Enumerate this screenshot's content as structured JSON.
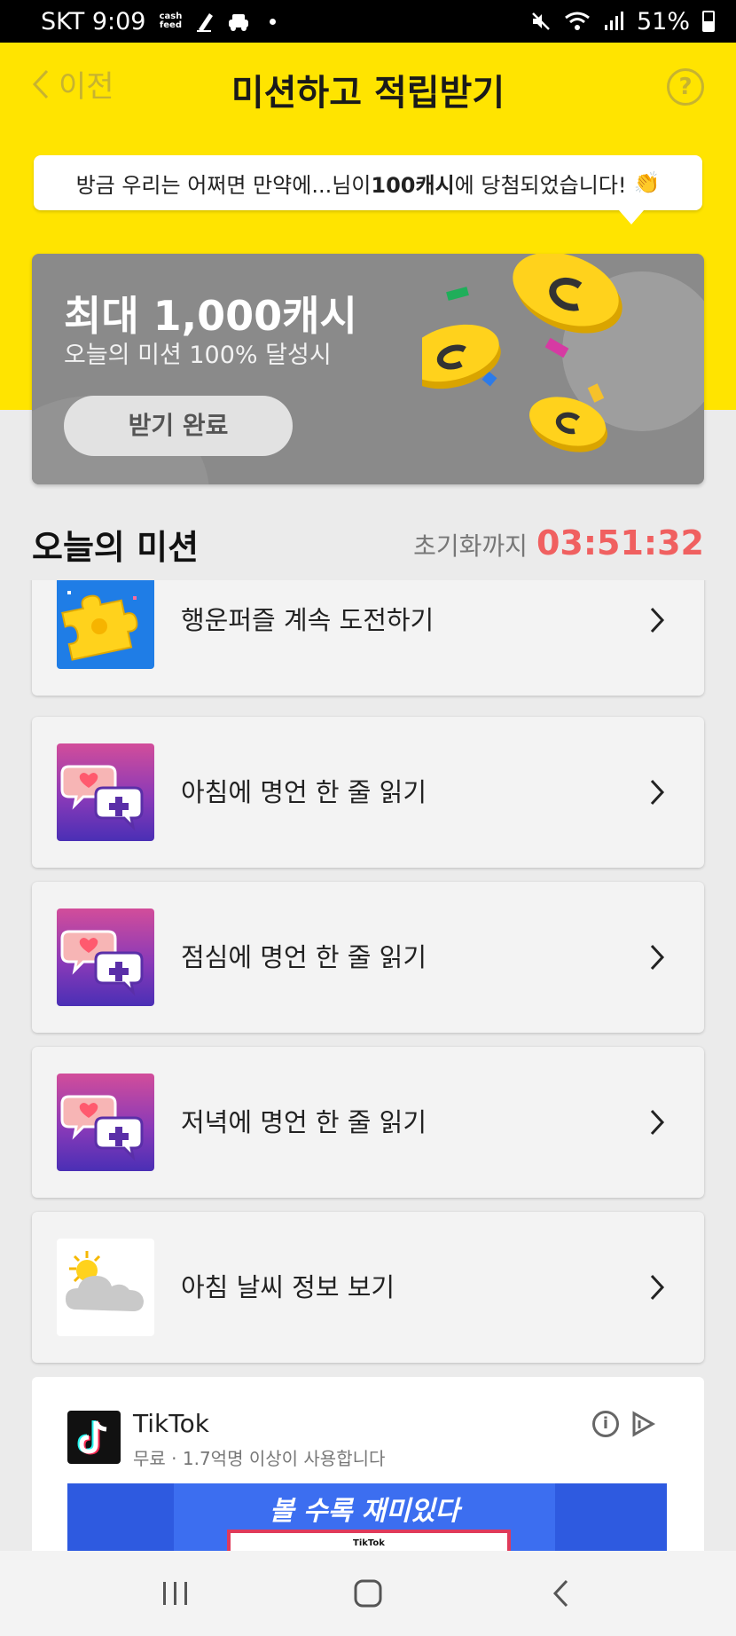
{
  "status_bar": {
    "carrier_time": "SKT 9:09",
    "app_badge": "cash feed",
    "battery": "51%"
  },
  "header": {
    "back_label": "이전",
    "title": "미션하고 적립받기",
    "help_label": "?"
  },
  "bubble": {
    "prefix": "방금 우리는 어쩌면 만약에...님이 ",
    "highlight": "100캐시",
    "suffix": "에 당첨되었습니다!",
    "emoji": "👏"
  },
  "promo": {
    "title": "최대 1,000캐시",
    "subtitle": "오늘의 미션 100% 달성시",
    "button_label": "받기 완료"
  },
  "section": {
    "title": "오늘의 미션",
    "reset_label": "초기화까지",
    "reset_time": "03:51:32"
  },
  "missions": [
    {
      "label": "행운퍼즐 계속 도전하기",
      "icon": "puzzle-icon"
    },
    {
      "label": "아침에 명언 한 줄 읽기",
      "icon": "quote-chat-icon"
    },
    {
      "label": "점심에 명언 한 줄 읽기",
      "icon": "quote-chat-icon"
    },
    {
      "label": "저녁에 명언 한 줄 읽기",
      "icon": "quote-chat-icon"
    },
    {
      "label": "아침 날씨 정보 보기",
      "icon": "weather-icon"
    }
  ],
  "ad": {
    "name": "TikTok",
    "subtitle": "무료 · 1.7억명 이상이 사용합니다",
    "banner_text": "볼 수록 재미있다",
    "banner_brand": "TikTok"
  },
  "colors": {
    "yellow": "#ffe400",
    "timer_red": "#f06060",
    "promo_gray": "#8a8a8a"
  }
}
